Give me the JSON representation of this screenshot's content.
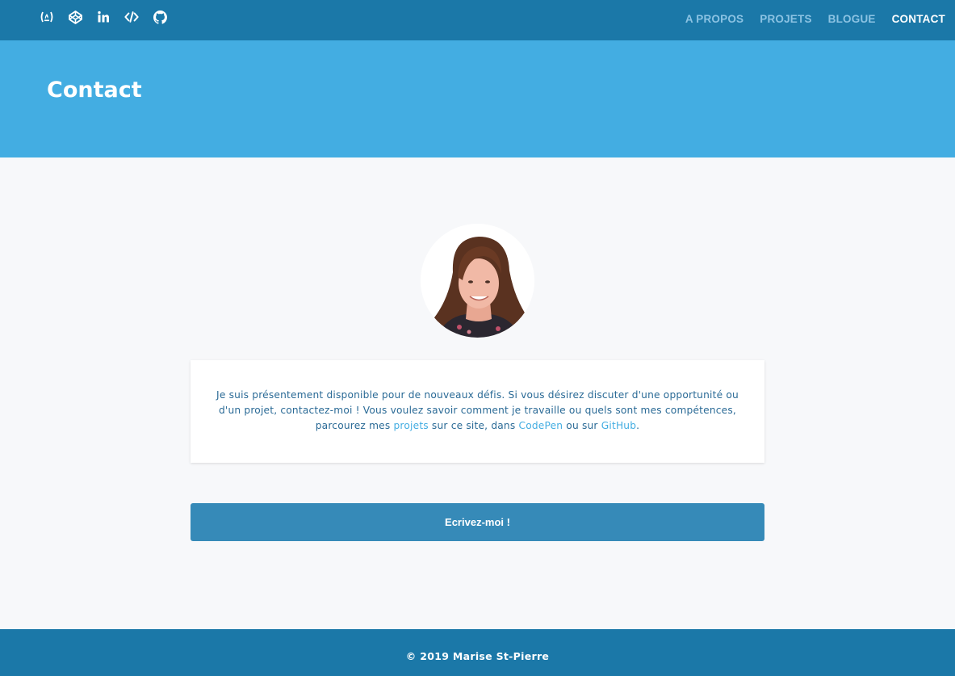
{
  "social": {
    "icons": [
      "fcc-icon",
      "codepen-icon",
      "linkedin-icon",
      "code-icon",
      "github-icon"
    ]
  },
  "nav": {
    "items": [
      {
        "label": "A PROPOS",
        "active": false
      },
      {
        "label": "PROJETS",
        "active": false
      },
      {
        "label": "BLOGUE",
        "active": false
      },
      {
        "label": "CONTACT",
        "active": true
      }
    ]
  },
  "hero": {
    "title": "Contact"
  },
  "intro": {
    "text_1": "Je suis présentement disponible pour de nouveaux défis. Si vous désirez discuter d'une opportunité ou d'un projet, contactez-moi ! Vous voulez savoir comment je travaille ou quels sont mes compétences, parcourez mes ",
    "link_projects": "projets",
    "text_2": " sur ce site, dans ",
    "link_codepen": "CodePen",
    "text_3": " ou sur ",
    "link_github": "GitHub",
    "text_4": "."
  },
  "cta": {
    "label": "Ecrivez-moi !"
  },
  "footer": {
    "copyright": "© 2019 Marise St-Pierre"
  },
  "colors": {
    "topbar": "#1b78a8",
    "hero": "#43ade2",
    "button": "#368ab8",
    "link": "#43ade2",
    "nav_inactive": "#8cc3e3"
  }
}
